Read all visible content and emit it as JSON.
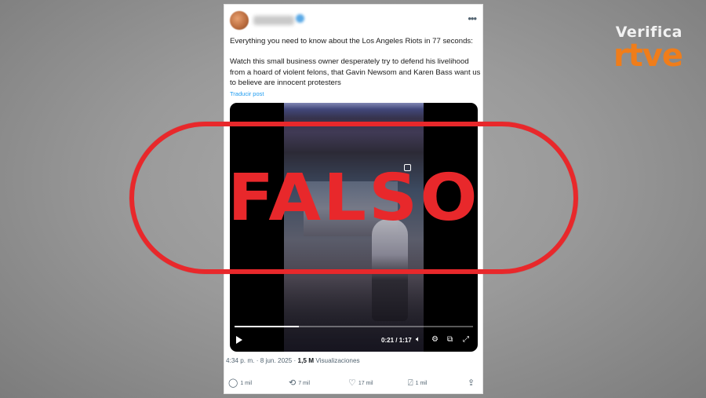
{
  "brand": {
    "top": "Verifica",
    "bottom": "rtve",
    "accent": "#f07d1a"
  },
  "tweet": {
    "title": "Everything you need to know about the Los Angeles Riots in 77 seconds:",
    "body": "Watch this small business owner desperately try to defend his livelihood from a hoard of violent felons, that Gavin Newsom and Karen Bass want us to believe are innocent protesters",
    "translate_label": "Traducir post",
    "more_icon": "more-dots-icon",
    "video": {
      "current_time": "0:21",
      "separator": "/",
      "duration": "1:17",
      "progress": 0.27
    },
    "meta": {
      "time": "4:34 p. m.",
      "dot": "·",
      "date": "8 jun. 2025",
      "views_count": "1,5 M",
      "views_label": "Visualizaciones"
    },
    "actions": {
      "replies": "1 mil",
      "reposts": "7 mil",
      "likes": "17 mil",
      "bookmarks": "1 mil"
    }
  },
  "stamp": {
    "text": "FALSO",
    "color": "#e8282b"
  }
}
